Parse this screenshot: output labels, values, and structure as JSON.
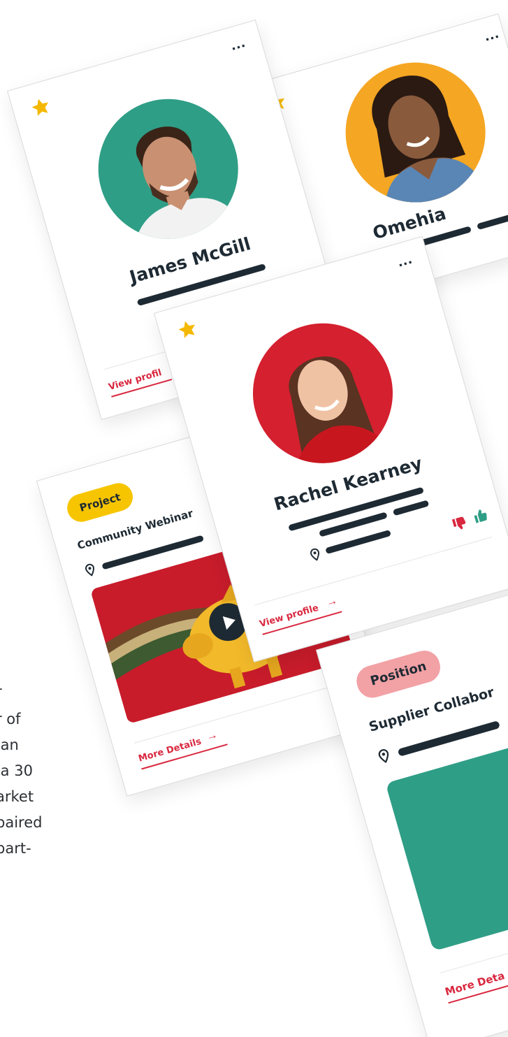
{
  "background_text": {
    "lines": [
      "r",
      "r of",
      " an",
      " a 30",
      "arket",
      "paired",
      "part-"
    ]
  },
  "card_james": {
    "name": "James McGill",
    "menu": "...",
    "link": "View profil"
  },
  "card_omehia": {
    "name": "Omehia",
    "menu": "..."
  },
  "card_rachel": {
    "name": "Rachel Kearney",
    "menu": "...",
    "link": "View profile"
  },
  "card_project": {
    "badge": "Project",
    "title": "Community Webinar",
    "link": "More Details"
  },
  "card_position": {
    "badge": "Position",
    "title": "Supplier Collabor",
    "link": "More Deta"
  },
  "colors": {
    "accent_red": "#d9283f",
    "dark": "#1e2a33",
    "star": "#f5b800",
    "green": "#2f9e86",
    "yellow": "#f5a623",
    "red": "#d4202f",
    "badge_project": "#f7c500",
    "badge_position": "#f2a1a5"
  }
}
